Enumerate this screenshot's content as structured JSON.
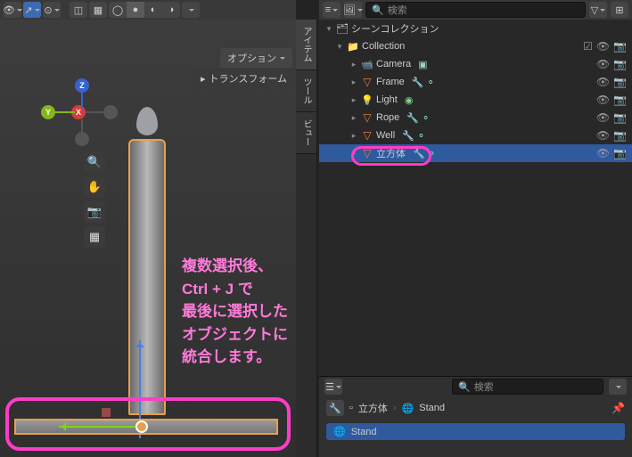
{
  "header": {
    "options_label": "オプション",
    "transform_label": "トランスフォーム"
  },
  "tabs": {
    "item": "アイテム",
    "tool": "ツール",
    "view": "ビュー"
  },
  "outliner": {
    "scene": "シーンコレクション",
    "collection": "Collection",
    "items": [
      {
        "name": "Camera"
      },
      {
        "name": "Frame"
      },
      {
        "name": "Light"
      },
      {
        "name": "Rope"
      },
      {
        "name": "Well"
      },
      {
        "name": "立方体"
      }
    ]
  },
  "annotation": {
    "l1": "複数選択後、 Ctrl + J で",
    "l2": "最後に選択したオブジェクトに",
    "l3": "統合します。"
  },
  "search": {
    "ph1": "検索",
    "ph2": "検索"
  },
  "props": {
    "crumb_obj": "立方体",
    "crumb_mod": "Stand",
    "field": "Stand"
  },
  "axes": {
    "x": "X",
    "y": "Y",
    "z": "Z"
  }
}
